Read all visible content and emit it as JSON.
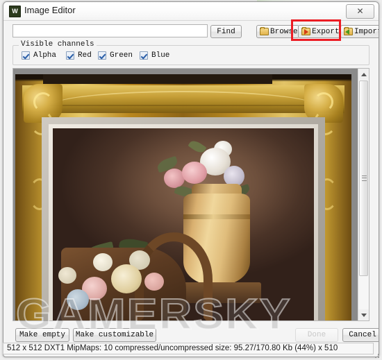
{
  "window": {
    "title": "Image Editor",
    "app_icon": "W",
    "close_label": "✕"
  },
  "toolbar": {
    "search_value": "",
    "search_placeholder": "",
    "find_label": "Find",
    "browse_label": "Browse",
    "export_label": "Export",
    "import_label": "Import"
  },
  "channels": {
    "group_title": "Visible channels",
    "items": [
      {
        "label": "Alpha",
        "checked": true
      },
      {
        "label": "Red",
        "checked": true
      },
      {
        "label": "Green",
        "checked": true
      },
      {
        "label": "Blue",
        "checked": true
      }
    ]
  },
  "preview": {
    "description": "Still-life oil painting in an ornate gold baroque frame: a tall cream pitcher holding white and pink roses beside a wicker basket of pale flowers, warm brown background",
    "scroll_position": "top"
  },
  "footer": {
    "make_empty_label": "Make empty",
    "make_customizable_label": "Make customizable",
    "done_label": "Done",
    "done_enabled": false,
    "cancel_label": "Cancel"
  },
  "statusbar": {
    "text": "512 x 512 DXT1 MipMaps: 10 compressed/uncompressed size: 95.27/170.80 Kb (44%)  x 510"
  },
  "watermark": {
    "text": "GAMERSKY"
  },
  "annotation": {
    "target": "Export",
    "color": "#ec1c24"
  },
  "colors": {
    "annotation_red": "#ec1c24",
    "window_bg": "#f4f4f4",
    "canvas_bg": "#8a8a8a",
    "checkbox_check": "#2a5ea8"
  }
}
